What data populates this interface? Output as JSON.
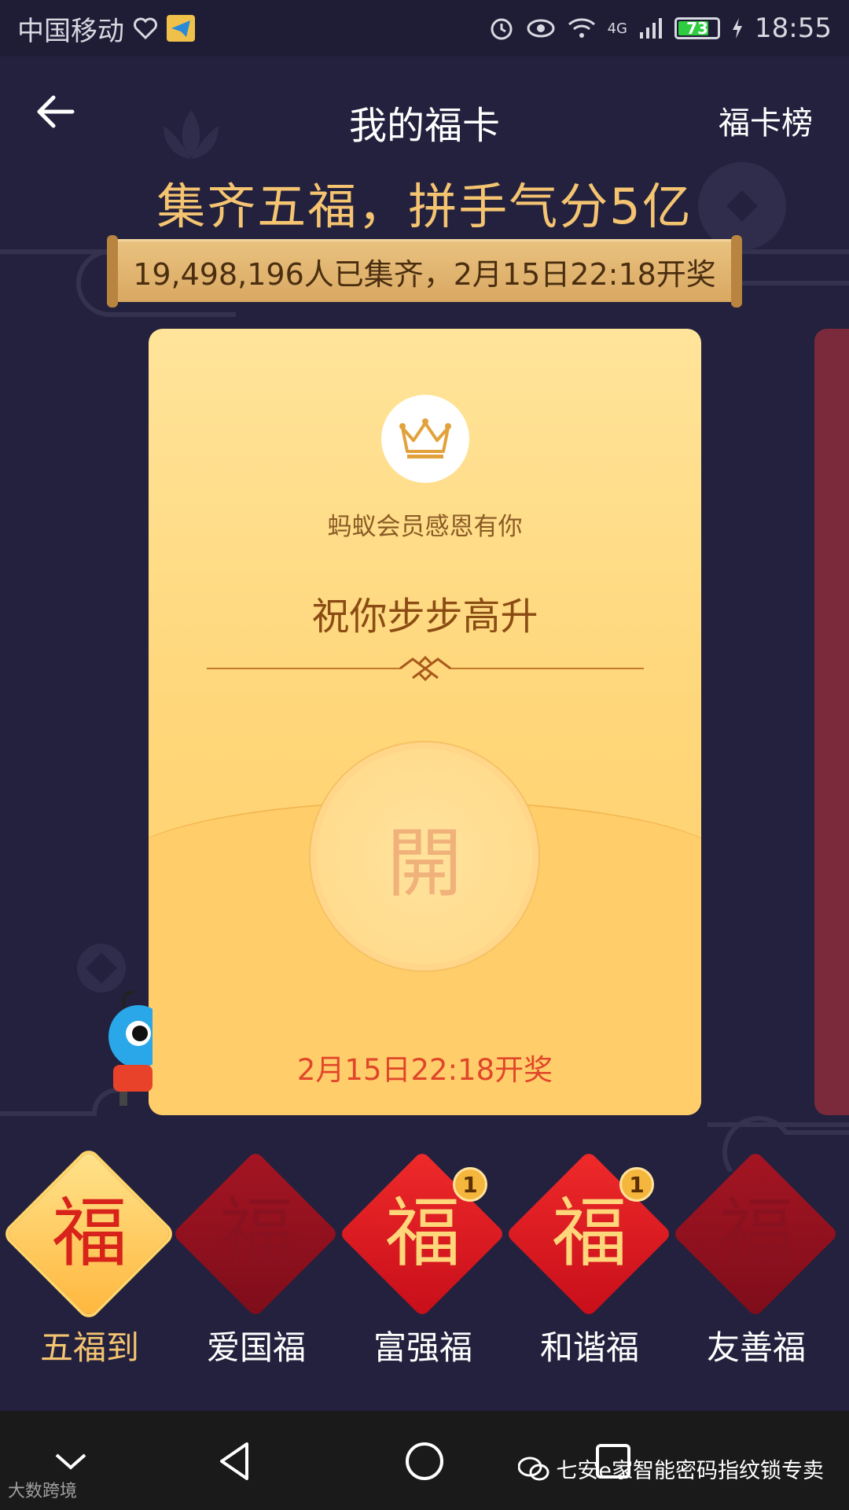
{
  "status_bar": {
    "carrier": "中国移动",
    "network": "4G",
    "battery": "73",
    "time": "18:55"
  },
  "nav": {
    "title": "我的福卡",
    "right_link": "福卡榜"
  },
  "headline": "集齐五福，拼手气分5亿",
  "banner": "19,498,196人已集齐，2月15日22:18开奖",
  "card": {
    "member_text": "蚂蚁会员感恩有你",
    "wish_text": "祝你步步高升",
    "open_label": "開",
    "draw_time": "2月15日22:18开奖"
  },
  "fu_cards": [
    {
      "label": "五福到",
      "glyph": "福",
      "style": "gold",
      "badge": ""
    },
    {
      "label": "爱国福",
      "glyph": "福",
      "style": "dark",
      "badge": ""
    },
    {
      "label": "富强福",
      "glyph": "福",
      "style": "red",
      "badge": "1"
    },
    {
      "label": "和谐福",
      "glyph": "福",
      "style": "red",
      "badge": "1"
    },
    {
      "label": "友善福",
      "glyph": "福",
      "style": "dark",
      "badge": ""
    }
  ],
  "watermark": {
    "right": "七安e家智能密码指纹锁专卖",
    "left": "大数跨境"
  },
  "colors": {
    "background": "#23213d",
    "gold_text": "#f4c471",
    "red_text": "#e0462a"
  }
}
